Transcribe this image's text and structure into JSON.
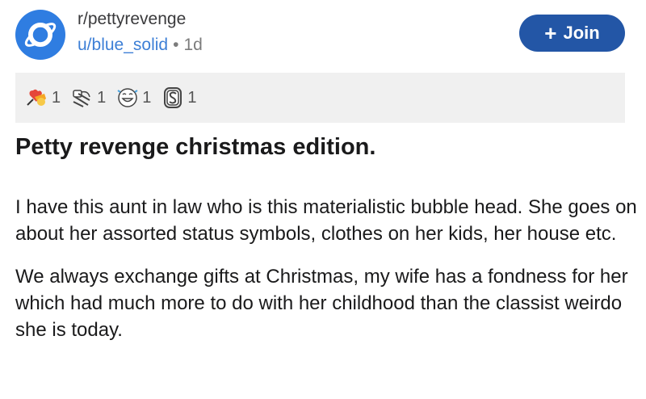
{
  "post": {
    "subreddit": "r/pettyrevenge",
    "author": "u/blue_solid",
    "separator": "•",
    "age": "1d",
    "join_label": "Join",
    "join_icon": "+",
    "awards": [
      {
        "icon": "wholesome-seal-icon",
        "count": "1"
      },
      {
        "icon": "hug-icon",
        "count": "1"
      },
      {
        "icon": "laughing-face-icon",
        "count": "1"
      },
      {
        "icon": "silver-award-icon",
        "count": "1"
      }
    ],
    "title": "Petty revenge christmas edition.",
    "paragraphs": [
      "I have this aunt in law who is this materialistic bubble head. She goes on about her assorted status symbols, clothes on her kids, her house etc.",
      "We always exchange gifts at Christmas, my wife has a fondness for her which had much more to do with her childhood than the classist weirdo she is today."
    ]
  },
  "colors": {
    "avatar_bg": "#2f7de1",
    "join_bg": "#2356a6",
    "author_link": "#3d7fd6",
    "awards_bg": "#f0f0f0"
  }
}
